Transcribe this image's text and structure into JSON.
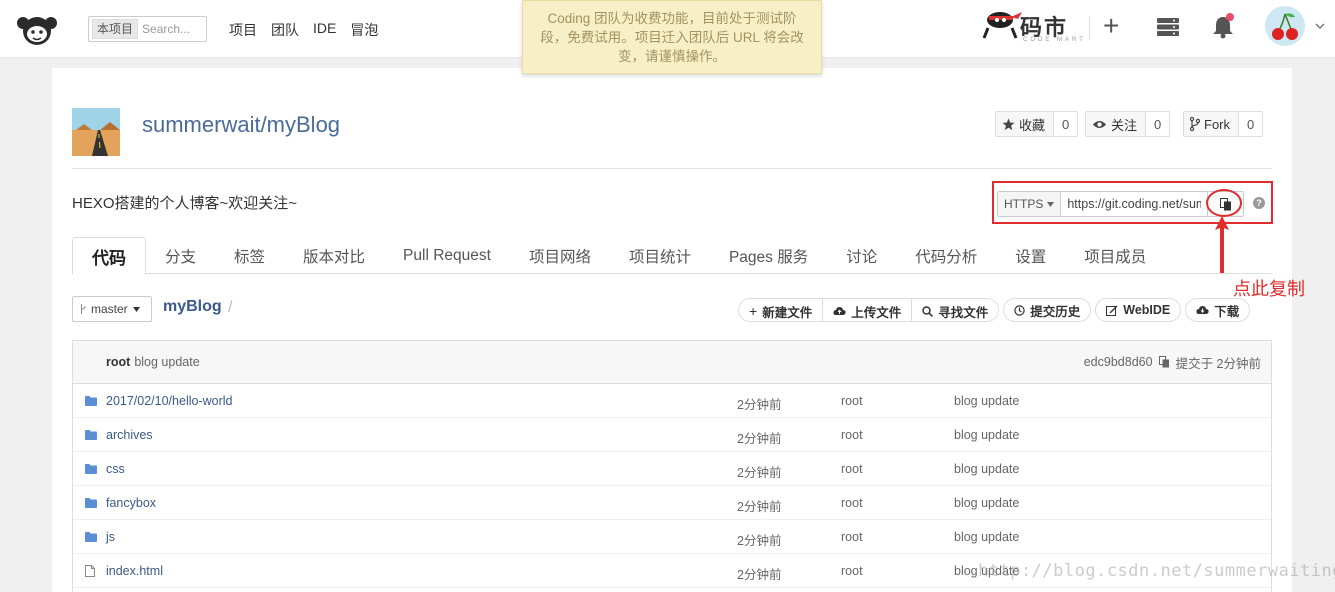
{
  "nav": {
    "search_scope": "本项目",
    "search_placeholder": "Search...",
    "links": [
      "项目",
      "团队",
      "IDE",
      "冒泡"
    ]
  },
  "notice": {
    "text": "Coding 团队为收费功能，目前处于测试阶段，免费试用。项目迁入团队后 URL 将会改变，请谨慎操作。"
  },
  "brand": {
    "name": "码市",
    "sub": "CODE MART"
  },
  "project": {
    "title": "summerwait/myBlog",
    "description": "HEXO搭建的个人博客~欢迎关注~",
    "star_label": "收藏",
    "star_count": "0",
    "watch_label": "关注",
    "watch_count": "0",
    "fork_label": "Fork",
    "fork_count": "0"
  },
  "clone": {
    "protocol": "HTTPS",
    "url": "https://git.coding.net/summerwait/myBlog.git"
  },
  "annotation": {
    "text": "点此复制"
  },
  "tabs": [
    "代码",
    "分支",
    "标签",
    "版本对比",
    "Pull Request",
    "项目网络",
    "项目统计",
    "Pages 服务",
    "讨论",
    "代码分析",
    "设置",
    "项目成员"
  ],
  "toolbar": {
    "branch": "master",
    "repo": "myBlog",
    "slash": "/",
    "new_file": "新建文件",
    "upload_file": "上传文件",
    "find_file": "寻找文件",
    "history": "提交历史",
    "webide": "WebIDE",
    "download": "下载"
  },
  "commit": {
    "author": "root",
    "message": "blog update",
    "hash": "edc9bd8d60",
    "time": "提交于 2分钟前"
  },
  "files": [
    {
      "name": "2017/02/10/hello-world",
      "type": "folder",
      "time": "2分钟前",
      "author": "root",
      "message": "blog update"
    },
    {
      "name": "archives",
      "type": "folder",
      "time": "2分钟前",
      "author": "root",
      "message": "blog update"
    },
    {
      "name": "css",
      "type": "folder",
      "time": "2分钟前",
      "author": "root",
      "message": "blog update"
    },
    {
      "name": "fancybox",
      "type": "folder",
      "time": "2分钟前",
      "author": "root",
      "message": "blog update"
    },
    {
      "name": "js",
      "type": "folder",
      "time": "2分钟前",
      "author": "root",
      "message": "blog update"
    },
    {
      "name": "index.html",
      "type": "file",
      "time": "2分钟前",
      "author": "root",
      "message": "blog update"
    }
  ],
  "watermark": "http://blog.csdn.net/summerwaiting",
  "colors": {
    "accent_red": "#e02c2c",
    "link_blue": "#3a5a8a",
    "folder_blue": "#5a8fd6",
    "notice_bg": "#f7f0c7"
  }
}
